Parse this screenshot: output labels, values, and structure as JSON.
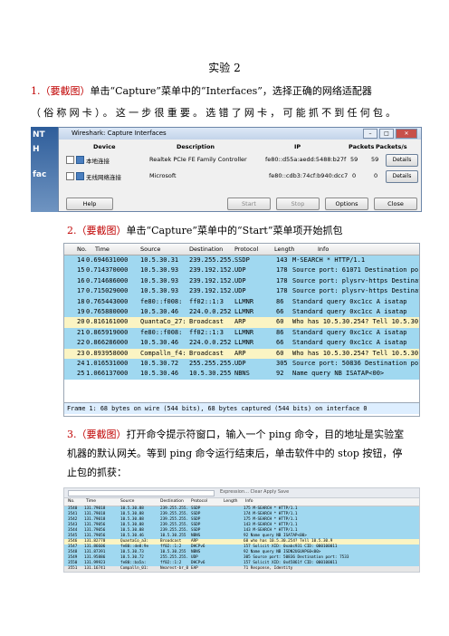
{
  "doc": {
    "title": "实验 2",
    "step1_num": "1.",
    "step1_mark": "（要截图）",
    "step1_text_a": "单击“Capture”菜单中的“Interfaces”，选择正确的网络适配器",
    "step1_text_b": "（俗称网卡）。这一步很重要。选错了网卡，可能抓不到任何包。",
    "step2_num": "2.",
    "step2_mark": "（要截图）",
    "step2_text": "单击“Capture”菜单中的“Start”菜单项开始抓包",
    "step3_num": "3.",
    "step3_mark": "（要截图）",
    "step3_text": "打开命令提示符窗口，输入一个 ping 命令，目的地址是实验室机器的默认网关。等到 ping 命令运行结束后，单击软件中的 stop 按钮，停止包的抓获："
  },
  "dialog": {
    "title": "Wireshark: Capture Interfaces",
    "headers": {
      "device": "Device",
      "description": "Description",
      "ip": "IP",
      "packets": "Packets",
      "packets_s": "Packets/s"
    },
    "rows": [
      {
        "device": "本地连接",
        "description": "Realtek PCIe FE Family Controller",
        "ip": "fe80::d55a:aedd:5488:b27f",
        "packets": "59",
        "packets_s": "59",
        "details": "Details"
      },
      {
        "device": "无线网络连接",
        "description": "Microsoft",
        "ip": "fe80::cdb3:74cf:b940:dcc7",
        "packets": "0",
        "packets_s": "0",
        "details": "Details"
      }
    ],
    "buttons": {
      "help": "Help",
      "start": "Start",
      "stop": "Stop",
      "options": "Options",
      "close": "Close"
    }
  },
  "packets": {
    "headers": {
      "no": "No.",
      "time": "Time",
      "source": "Source",
      "destination": "Destination",
      "protocol": "Protocol",
      "length": "Length",
      "info": "Info"
    },
    "rows": [
      {
        "no": "14",
        "time": "0.694631000",
        "source": "10.5.30.31",
        "destination": "239.255.255.",
        "protocol": "SSDP",
        "length": "143",
        "info": "M-SEARCH * HTTP/1.1",
        "color": "#a0d8f0"
      },
      {
        "no": "15",
        "time": "0.714370000",
        "source": "10.5.30.93",
        "destination": "239.192.152.",
        "protocol": "UDP",
        "length": "178",
        "info": "Source port: 61071  Destination port: p",
        "color": "#a0d8f0"
      },
      {
        "no": "16",
        "time": "0.714686000",
        "source": "10.5.30.93",
        "destination": "239.192.152.",
        "protocol": "UDP",
        "length": "178",
        "info": "Source port: plysrv-https  Destination",
        "color": "#a0d8f0"
      },
      {
        "no": "17",
        "time": "0.715029000",
        "source": "10.5.30.93",
        "destination": "239.192.152.",
        "protocol": "UDP",
        "length": "178",
        "info": "Source port: plysrv-https  Destination",
        "color": "#a0d8f0"
      },
      {
        "no": "18",
        "time": "0.765443000",
        "source": "fe80::f008:",
        "destination": "ff02::1:3",
        "protocol": "LLMNR",
        "length": "86",
        "info": "Standard query 0xc1cc  A isatap",
        "color": "#a0d8f0"
      },
      {
        "no": "19",
        "time": "0.765880000",
        "source": "10.5.30.46",
        "destination": "224.0.0.252",
        "protocol": "LLMNR",
        "length": "66",
        "info": "Standard query 0xc1cc  A isatap",
        "color": "#a0d8f0"
      },
      {
        "no": "20",
        "time": "0.816161000",
        "source": "QuantaCo_27:",
        "destination": "Broadcast",
        "protocol": "ARP",
        "length": "60",
        "info": "Who has 10.5.30.254?  Tell 10.5.30.74",
        "color": "#fbf4c3"
      },
      {
        "no": "21",
        "time": "0.865919000",
        "source": "fe80::f008:",
        "destination": "ff02::1:3",
        "protocol": "LLMNR",
        "length": "86",
        "info": "Standard query 0xc1cc  A isatap",
        "color": "#a0d8f0"
      },
      {
        "no": "22",
        "time": "0.866286000",
        "source": "10.5.30.46",
        "destination": "224.0.0.252",
        "protocol": "LLMNR",
        "length": "66",
        "info": "Standard query 0xc1cc  A isatap",
        "color": "#a0d8f0"
      },
      {
        "no": "23",
        "time": "0.893958000",
        "source": "Compalln_f4:",
        "destination": "Broadcast",
        "protocol": "ARP",
        "length": "60",
        "info": "Who has 10.5.30.254?  Tell 10.5.30.10",
        "color": "#fbf4c3"
      },
      {
        "no": "24",
        "time": "1.016531000",
        "source": "10.5.30.72",
        "destination": "255.255.255.",
        "protocol": "UDP",
        "length": "305",
        "info": "Source port: 50836  Destination port: 7",
        "color": "#a0d8f0"
      },
      {
        "no": "25",
        "time": "1.066137000",
        "source": "10.5.30.46",
        "destination": "10.5.30.255",
        "protocol": "NBNS",
        "length": "92",
        "info": "Name query NB ISATAP<00>",
        "color": "#a0d8f0"
      }
    ],
    "detail_line": "Frame 1: 68 bytes on wire (544 bits), 68 bytes captured (544 bits) on interface 0"
  },
  "shot3": {
    "toolbar_label": "Expression...   Clear   Apply   Save",
    "headers": {
      "no": "No.",
      "time": "Time",
      "source": "Source",
      "destination": "Destination",
      "protocol": "Protocol",
      "length": "Length",
      "info": "Info"
    },
    "rows": [
      {
        "no": "3540",
        "time": "131.79018",
        "source": "10.5.30.88",
        "destination": "239.255.255.",
        "protocol": "SSDP",
        "info": "175 M-SEARCH * HTTP/1.1",
        "color": "#a0d8f0"
      },
      {
        "no": "3541",
        "time": "131.79018",
        "source": "10.5.30.88",
        "destination": "239.255.255.",
        "protocol": "SSDP",
        "info": "174 M-SEARCH * HTTP/1.1",
        "color": "#a0d8f0"
      },
      {
        "no": "3542",
        "time": "131.79018",
        "source": "10.5.30.88",
        "destination": "239.255.255.",
        "protocol": "SSDP",
        "info": "175 M-SEARCH * HTTP/1.1",
        "color": "#a0d8f0"
      },
      {
        "no": "3543",
        "time": "131.79056",
        "source": "10.5.30.88",
        "destination": "239.255.255.",
        "protocol": "SSDP",
        "info": "143 M-SEARCH * HTTP/1.1",
        "color": "#a0d8f0"
      },
      {
        "no": "3544",
        "time": "131.79056",
        "source": "10.5.30.88",
        "destination": "239.255.255.",
        "protocol": "SSDP",
        "info": "143 M-SEARCH * HTTP/1.1",
        "color": "#a0d8f0"
      },
      {
        "no": "3545",
        "time": "131.79056",
        "source": "10.5.30.46",
        "destination": "10.5.30.255",
        "protocol": "NBNS",
        "info": "92 Name query NB ISATAP<00>",
        "color": "#a0d8f0"
      },
      {
        "no": "3546",
        "time": "131.82770",
        "source": "QuantaCo_a3:",
        "destination": "Broadcast",
        "protocol": "ARP",
        "info": "60 who has 10.5.30.254? Tell 10.5.30.9",
        "color": "#fbf4c3"
      },
      {
        "no": "3547",
        "time": "131.86606",
        "source": "fe80::de8:9e",
        "destination": "ff02::1:2",
        "protocol": "DHCPv6",
        "info": "157 Solicit XID: 0xabc931 CID: 000100011",
        "color": "#a0d8f0"
      },
      {
        "no": "3548",
        "time": "131.87391",
        "source": "10.5.30.73",
        "destination": "10.5.30.255",
        "protocol": "NBNS",
        "info": "92 Name query NB ISDN2UGUAPG0<00>",
        "color": "#a0d8f0"
      },
      {
        "no": "3549",
        "time": "131.95886",
        "source": "10.5.30.72",
        "destination": "255.255.255.",
        "protocol": "UDP",
        "info": "305 Source port: 50836  Destination port: 7533",
        "color": "#a0d8f0"
      },
      {
        "no": "3550",
        "time": "131.99923",
        "source": "fe80::ba5a:",
        "destination": "ff02::1:2",
        "protocol": "DHCPv6",
        "info": "157 Solicit XID: 0x45861f CID: 000100011",
        "color": "#a0d8f0"
      },
      {
        "no": "3551",
        "time": "131.16741",
        "source": "Compalln_01:",
        "destination": "Nearest-br_0",
        "protocol": "EAP",
        "info": "71 Response, Identity",
        "color": "#e6e6e6"
      }
    ]
  }
}
